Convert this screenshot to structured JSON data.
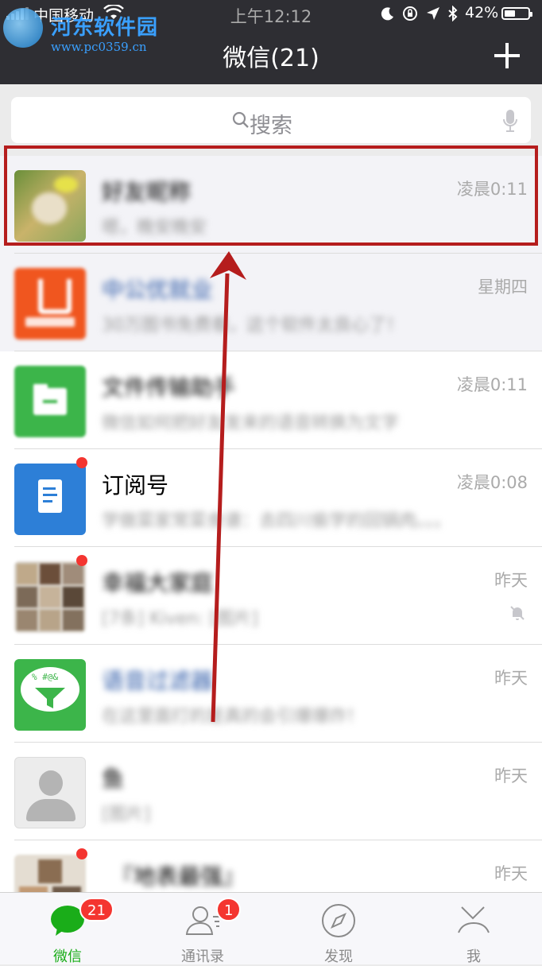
{
  "status_bar": {
    "carrier": "中国移动",
    "time": "上午12:12",
    "battery_percent": "42%"
  },
  "watermark": {
    "name": "河东软件园",
    "url": "www.pc0359.cn"
  },
  "header": {
    "title": "微信(21)",
    "add_icon": "plus-icon"
  },
  "search": {
    "placeholder": "搜索",
    "icon": "search-icon",
    "mic_icon": "mic-icon"
  },
  "chats": [
    {
      "name": "好友昵称",
      "preview": "嗯，晚安晚安",
      "time": "凌晨0:11",
      "unread": false,
      "pinned": true,
      "muted": false,
      "blurred_name": true,
      "avatar": "photo-avatar"
    },
    {
      "name": "中公优就业",
      "preview": "30万图书免费看，这个软件太良心了！",
      "time": "星期四",
      "unread": false,
      "pinned": true,
      "muted": false,
      "blurred_name": true,
      "avatar": "brand-u-avatar"
    },
    {
      "name": "文件传输助手",
      "preview": "微信如何把好友发来的语音转换为文字",
      "time": "凌晨0:11",
      "unread": false,
      "pinned": false,
      "muted": false,
      "blurred_name": true,
      "avatar": "folder-avatar"
    },
    {
      "name": "订阅号",
      "preview": "学做菜家常菜食谱：去四川偷学的回锅肉。。。",
      "time": "凌晨0:08",
      "unread": true,
      "pinned": false,
      "muted": false,
      "blurred_name": false,
      "avatar": "subscription-avatar"
    },
    {
      "name": "幸福大家庭",
      "preview": "[7条] Kiven: [图片]",
      "time": "昨天",
      "unread": true,
      "pinned": false,
      "muted": true,
      "blurred_name": true,
      "avatar": "group-avatar"
    },
    {
      "name": "语音过滤器",
      "preview": "在这里面打的是真的会引爆爆炸！",
      "time": "昨天",
      "unread": false,
      "pinned": false,
      "muted": false,
      "blurred_name": true,
      "avatar": "funnel-avatar"
    },
    {
      "name": "鱼",
      "preview": "[图片]",
      "time": "昨天",
      "unread": false,
      "pinned": false,
      "muted": false,
      "blurred_name": true,
      "avatar": "default-person-avatar"
    },
    {
      "name": "『地表最强』",
      "preview": "",
      "time": "昨天",
      "unread": true,
      "pinned": false,
      "muted": false,
      "blurred_name": true,
      "avatar": "group-avatar-2"
    }
  ],
  "tabbar": [
    {
      "label": "微信",
      "icon": "chat-bubble-icon",
      "badge": "21",
      "active": true
    },
    {
      "label": "通讯录",
      "icon": "contacts-icon",
      "badge": "1",
      "active": false
    },
    {
      "label": "发现",
      "icon": "compass-icon",
      "badge": "",
      "active": false
    },
    {
      "label": "我",
      "icon": "me-icon",
      "badge": "",
      "active": false
    }
  ],
  "colors": {
    "header_bg": "#2e2e33",
    "accent_green": "#1aad19",
    "badge_red": "#f43530",
    "annotation_red": "#b51d1d"
  }
}
